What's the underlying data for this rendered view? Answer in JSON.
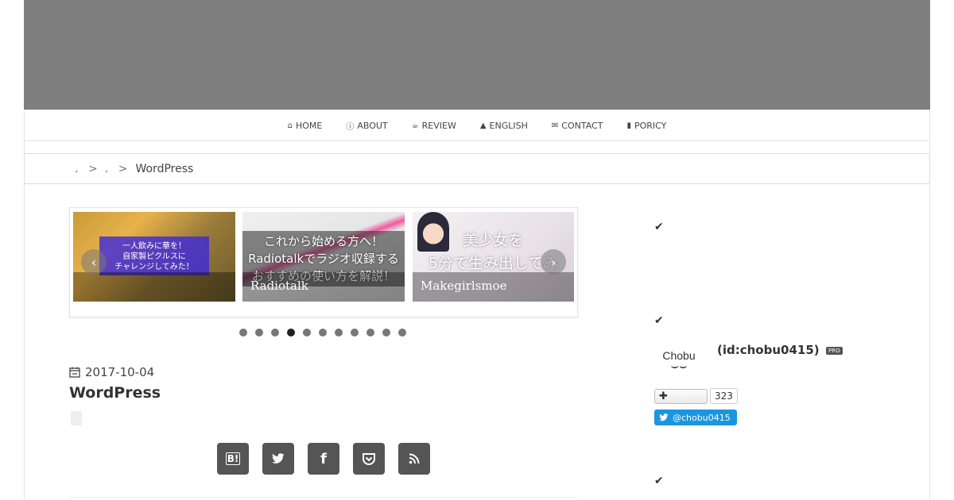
{
  "nav": {
    "items": [
      {
        "icon": "home-icon",
        "label": "HOME"
      },
      {
        "icon": "info-icon",
        "label": "ABOUT"
      },
      {
        "icon": "coffee-icon",
        "label": "REVIEW"
      },
      {
        "icon": "graduation-cap-icon",
        "label": "ENGLISH"
      },
      {
        "icon": "envelope-icon",
        "label": "CONTACT"
      },
      {
        "icon": "file-icon",
        "label": "PORICY"
      }
    ]
  },
  "breadcrumb": {
    "separator": ">",
    "current": "WordPress"
  },
  "slider": {
    "slides": [
      {
        "caption": "",
        "overlay_lines": [
          "一人飲みに華を！",
          "自家製ピクルスに",
          "チャレンジしてみた！"
        ]
      },
      {
        "caption": "Radiotalk",
        "overlay_lines": [
          "これから始める方へ！",
          "Radiotalkでラジオ収録する",
          "おすすめの使い方を解説！"
        ]
      },
      {
        "caption": "Makegirlsmoe",
        "overlay_lines": [
          "美少女を",
          "5分で生み出してみ"
        ]
      }
    ],
    "dots_count": 11,
    "active_dot": 3,
    "prev_symbol": "‹",
    "next_symbol": "›"
  },
  "post": {
    "date": "2017-10-04",
    "title": "WordPress"
  },
  "share": {
    "buttons": [
      {
        "icon": "hatena-bookmark-icon",
        "label": "B!"
      },
      {
        "icon": "twitter-icon",
        "label": "🐦"
      },
      {
        "icon": "facebook-icon",
        "label": "f"
      },
      {
        "icon": "pocket-icon",
        "label": "⌄"
      },
      {
        "icon": "rss-icon",
        "label": "◉"
      }
    ]
  },
  "sidebar": {
    "check_symbol": "✔",
    "profile": {
      "logo_text": "Chobu",
      "id": "(id:chobu0415)",
      "badge": "PRO",
      "follow_plus": "✚",
      "follower_count": "323",
      "twitter_handle": "@chobu0415"
    }
  },
  "colors": {
    "banner": "#7f7f7f",
    "share_button": "#555555",
    "twitter": "#1b95e0",
    "promo": "#3c28dc"
  }
}
